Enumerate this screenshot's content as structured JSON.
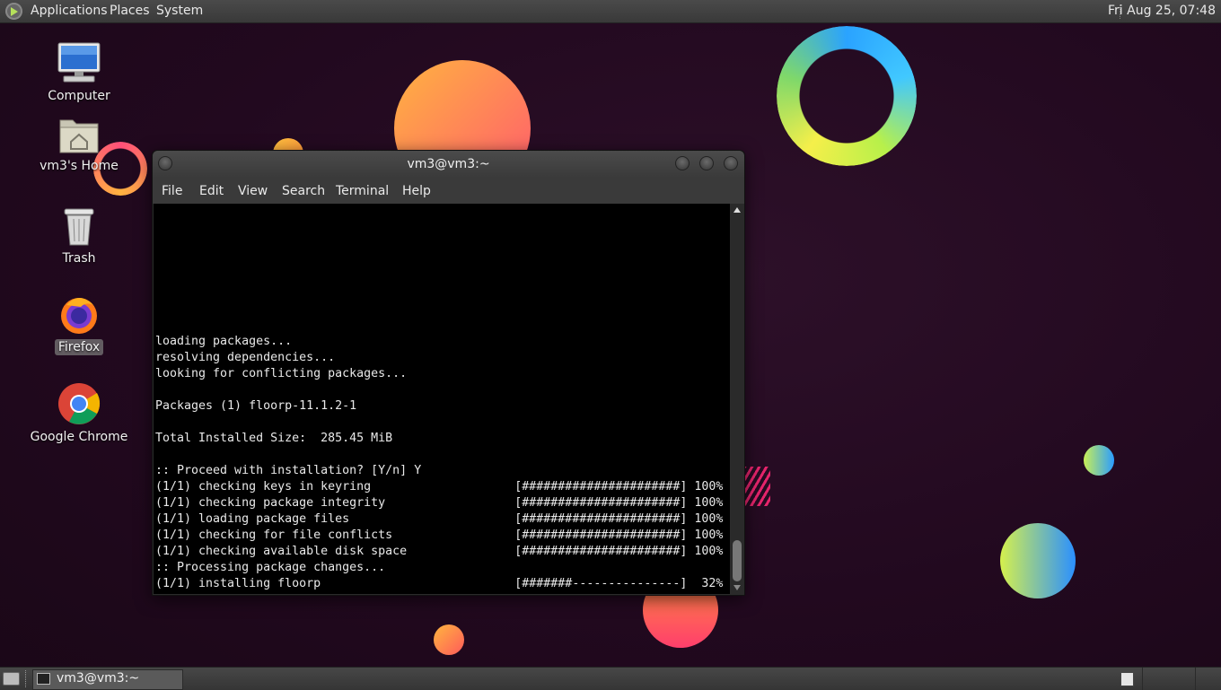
{
  "top_panel": {
    "menus": [
      "Applications",
      "Places",
      "System"
    ],
    "clock": "Fri Aug 25, 07:48"
  },
  "desktop_icons": [
    {
      "label": "Computer",
      "icon": "computer-icon"
    },
    {
      "label": "vm3's Home",
      "icon": "home-folder-icon"
    },
    {
      "label": "Trash",
      "icon": "trash-icon"
    },
    {
      "label": "Firefox",
      "icon": "firefox-icon"
    },
    {
      "label": "Google Chrome",
      "icon": "chrome-icon"
    }
  ],
  "window": {
    "title": "vm3@vm3:~",
    "menu": [
      "File",
      "Edit",
      "View",
      "Search",
      "Terminal",
      "Help"
    ]
  },
  "terminal": {
    "lines": [
      "loading packages...",
      "resolving dependencies...",
      "looking for conflicting packages...",
      "",
      "Packages (1) floorp-11.1.2-1",
      "",
      "Total Installed Size:  285.45 MiB",
      "",
      ":: Proceed with installation? [Y/n] Y",
      "(1/1) checking keys in keyring                    [######################] 100%",
      "(1/1) checking package integrity                  [######################] 100%",
      "(1/1) loading package files                       [######################] 100%",
      "(1/1) checking for file conflicts                 [######################] 100%",
      "(1/1) checking available disk space               [######################] 100%",
      ":: Processing package changes...",
      "(1/1) installing floorp                           [#######---------------]  32%"
    ]
  },
  "taskbar": {
    "task_label": "vm3@vm3:~"
  },
  "colors": {
    "panel": "#3f3f3f",
    "terminal_bg": "#000000",
    "terminal_fg": "#e9e9e9",
    "desktop_bg": "#22091f"
  }
}
